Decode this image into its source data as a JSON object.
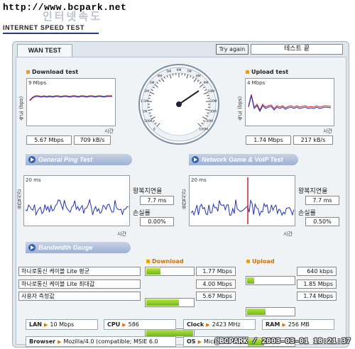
{
  "header": {
    "url": "http://www.bcpark.net",
    "korean_logo": "인터넷속도",
    "subtitle": "INTERNET SPEED TEST"
  },
  "tab": {
    "label": "WAN TEST"
  },
  "controls": {
    "try_again": "Try again",
    "status": "테스트 끝"
  },
  "download": {
    "title": "Download test",
    "scale": "9 Mbps",
    "ylabel": "속도 (bps)",
    "xlabel": "시간",
    "mbps": "5.67 Mbps",
    "kbs": "709 kB/s"
  },
  "upload": {
    "title": "Upload test",
    "scale": "4 Mbps",
    "ylabel": "속도 (bps)",
    "xlabel": "시간",
    "mbps": "1.74 Mbps",
    "kbs": "217 kB/s"
  },
  "gauge": {
    "ticks": [
      "0",
      "500K",
      "1M",
      "1.5M",
      "2M",
      "3M",
      "4M",
      "5M",
      "6M",
      "7M",
      "8M",
      "9M",
      "10M",
      "20M",
      "30M",
      "50M",
      "100M"
    ],
    "reading": "5.67 Mbps"
  },
  "sections": {
    "ping": "General Ping Test",
    "game": "Network Game & VoIP Test",
    "bandwidth": "Bandwidth Gauge"
  },
  "ping_left": {
    "scale": "20 ms",
    "ylabel": "응답시간",
    "xlabel": "시간",
    "rtt_label": "왕복지연율",
    "rtt_value": "7.7 ms",
    "loss_label": "손실률",
    "loss_value": "0.00%"
  },
  "ping_right": {
    "scale": "20 ms",
    "ylabel": "응답시간",
    "xlabel": "시간",
    "rtt_label": "왕복지연율",
    "rtt_value": "7.7 ms",
    "loss_label": "손실률",
    "loss_value": "0.50%"
  },
  "bandwidth": {
    "download_header": "Download",
    "upload_header": "Upload",
    "rows": [
      {
        "label": "하나로통신 케이블 Lite 평균",
        "down": "1.77 Mbps",
        "down_level": 0.31,
        "up": "640 kbps",
        "up_level": 0.37
      },
      {
        "label": "하나로통신 케이블 Lite 최대값",
        "down": "4.00 Mbps",
        "down_level": 0.7,
        "up": "1.85 Mbps",
        "up_level": 1.0
      },
      {
        "label": "사용자 측정값",
        "down": "5.67 Mbps",
        "down_level": 1.0,
        "up": "1.74 Mbps",
        "up_level": 0.94
      }
    ]
  },
  "system": {
    "lan_key": "LAN",
    "lan_val": "10 Mbps",
    "cpu_key": "CPU",
    "cpu_val": "586",
    "clock_key": "Clock",
    "clock_val": "2423 MHz",
    "ram_key": "RAM",
    "ram_val": "256 MB",
    "browser_key": "Browser",
    "browser_val": "Mozilla/4.0 (compatible; MSIE 6.0",
    "os_key": "OS",
    "os_val": "Microso"
  },
  "timestamp": "@BCPARK / 2003-03-01 18:21:37"
}
